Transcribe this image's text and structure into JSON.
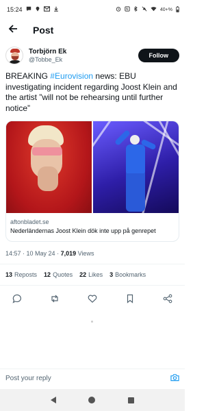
{
  "status_bar": {
    "time": "15:24",
    "battery": "40+%",
    "left_icons": [
      "chat-icon",
      "location-icon",
      "mail-icon",
      "download-icon"
    ],
    "right_icons": [
      "alarm-icon",
      "nfc-icon",
      "bluetooth-icon",
      "mute-icon",
      "wifi-icon",
      "battery-icon"
    ]
  },
  "header": {
    "back_icon": "back-arrow-icon",
    "title": "Post"
  },
  "author": {
    "name": "Torbjörn Ek",
    "handle": "@Tobbe_Ek",
    "follow_label": "Follow"
  },
  "tweet": {
    "prefix": "BREAKING ",
    "hashtag": "#Eurovision",
    "body": " news: EBU investigating incident regarding Joost Klein and the artist ”will not be rehearsing until further notice”"
  },
  "link_card": {
    "domain": "aftonbladet.se",
    "title": "Nederländernas Joost Klein dök inte upp på genrepet"
  },
  "meta": {
    "time": "14:57",
    "separator1": " · ",
    "date": "10 May 24",
    "separator2": " · ",
    "views_count": "7,019",
    "views_label": " Views"
  },
  "stats": {
    "reposts_count": "13",
    "reposts_label": "Reposts",
    "quotes_count": "12",
    "quotes_label": "Quotes",
    "likes_count": "22",
    "likes_label": "Likes",
    "bookmarks_count": "3",
    "bookmarks_label": "Bookmarks"
  },
  "actions": [
    "reply-icon",
    "repost-icon",
    "like-icon",
    "bookmark-icon",
    "share-icon"
  ],
  "reply_bar": {
    "placeholder": "Post your reply",
    "camera_icon": "camera-icon"
  },
  "colors": {
    "accent": "#1d9bf0",
    "text": "#0f1419",
    "muted": "#536471"
  }
}
